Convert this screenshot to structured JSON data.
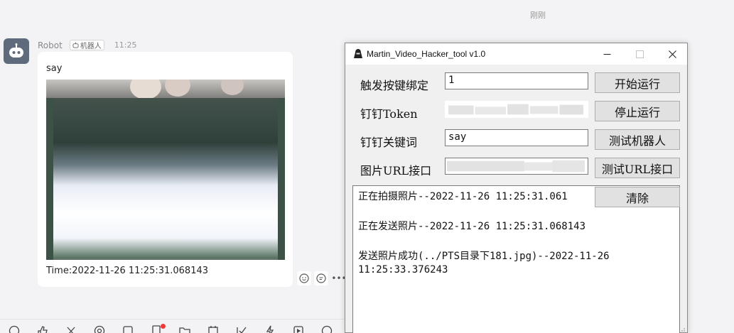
{
  "chat": {
    "timestamp_header": "刚刚",
    "sender": {
      "name": "Robot",
      "tag": "机器人",
      "time": "11:25"
    },
    "message": {
      "title": "say",
      "photo": "webcam-photo",
      "caption": "Time:2022-11-26 11:25:31.068143"
    },
    "actions": [
      "emoji-reply-icon",
      "comment-icon",
      "more-icon"
    ]
  },
  "toolbar": {
    "icons": [
      "emoji-icon",
      "like-icon",
      "scissors-icon",
      "at-icon",
      "checkbox-icon",
      "document-icon",
      "folder-icon",
      "calendar-icon",
      "approval-icon",
      "lightning-icon",
      "play-icon",
      "currency-icon"
    ],
    "notification_color": "#f03a3a"
  },
  "window": {
    "title": "Martin_Video_Hacker_tool v1.0",
    "controls": [
      "minimize-icon",
      "maximize-icon",
      "close-icon"
    ],
    "fields": [
      {
        "label": "触发按键绑定",
        "value": "1",
        "redacted": false
      },
      {
        "label": "钉钉Token",
        "value": "",
        "redacted": true
      },
      {
        "label": "钉钉关键词",
        "value": "say",
        "redacted": false
      },
      {
        "label": "图片URL接口",
        "value": "",
        "redacted": true
      }
    ],
    "buttons": {
      "start": "开始运行",
      "stop": "停止运行",
      "test_robot": "测试机器人",
      "test_url": "测试URL接口",
      "clear": "清除"
    },
    "log": [
      "正在拍摄照片--2022-11-26 11:25:31.061",
      "正在发送照片--2022-11-26 11:25:31.068143",
      "发送照片成功(../PTS目录下181.jpg)--2022-11-26",
      "11:25:33.376243"
    ]
  }
}
